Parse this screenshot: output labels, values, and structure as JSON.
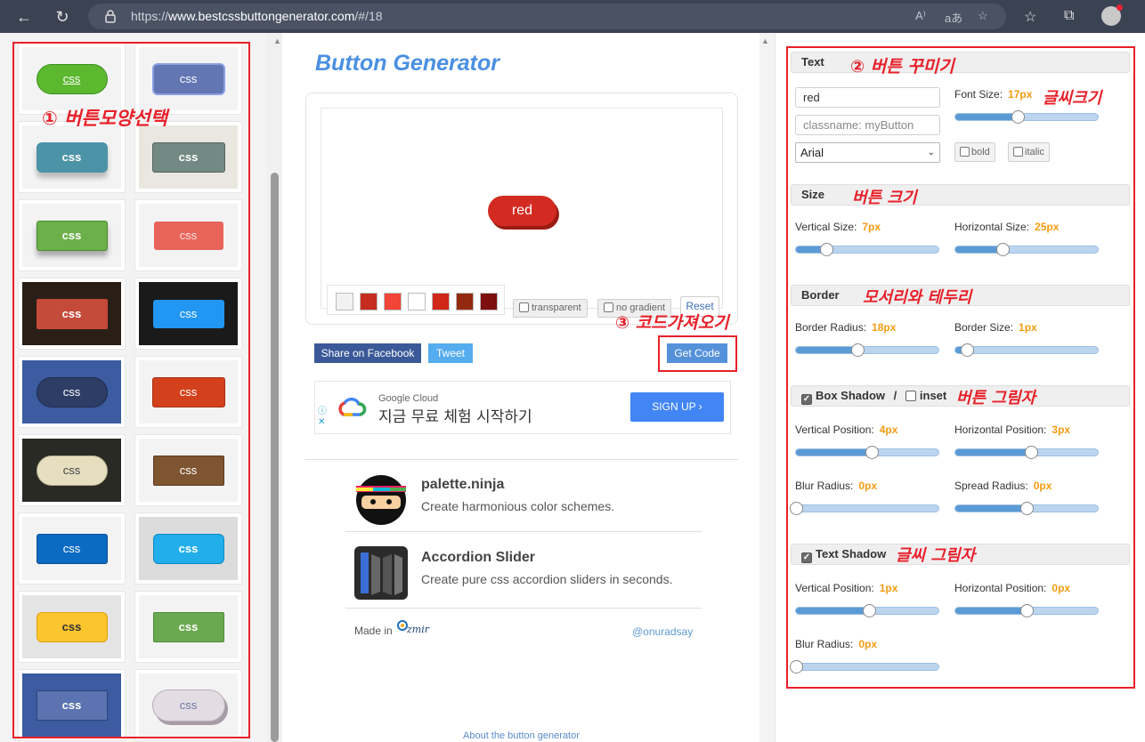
{
  "browser": {
    "url_prefix": "https://",
    "url_host": "www.bestcssbuttongenerator.com",
    "url_path": "/#/18"
  },
  "left": {
    "annotation": "① 버튼모양선택",
    "thumb_label": "css"
  },
  "center": {
    "title": "Button Generator",
    "preview_button_text": "red",
    "swatch_colors": [
      "#f2f2f2",
      "#c62d1f",
      "#f24437",
      "#ffffff",
      "#d02718",
      "#942911",
      "#7d0f0f"
    ],
    "transparent_label": "transparent",
    "no_gradient_label": "no gradient",
    "reset_label": "Reset",
    "facebook_label": "Share on Facebook",
    "tweet_label": "Tweet",
    "get_code_label": "Get Code",
    "code_annotation": "③ 코드가져오기",
    "ad": {
      "brand": "Google Cloud",
      "headline": "지금 무료 체험 시작하기",
      "cta": "SIGN UP"
    },
    "promos": [
      {
        "name": "palette.ninja",
        "desc": "Create harmonious color schemes."
      },
      {
        "name": "Accordion Slider",
        "desc": "Create pure css accordion sliders in seconds."
      }
    ],
    "made_in": "Made in",
    "twitter_handle": "@onuradsay",
    "about": "About the button generator"
  },
  "right": {
    "text_section": "Text",
    "text_annotation": "② 버튼 꾸미기",
    "text_value": "red",
    "classname_placeholder": "classname: myButton",
    "font_size_label": "Font Size:",
    "font_size_value": "17px",
    "font_size_annotation": "글씨크기",
    "font_select": "Arial",
    "bold_label": "bold",
    "italic_label": "italic",
    "size_section": "Size",
    "size_annotation": "버튼 크기",
    "vsize_label": "Vertical Size:",
    "vsize_value": "7px",
    "hsize_label": "Horizontal Size:",
    "hsize_value": "25px",
    "border_section": "Border",
    "border_annotation": "모서리와 테두리",
    "radius_label": "Border Radius:",
    "radius_value": "18px",
    "bsize_label": "Border Size:",
    "bsize_value": "1px",
    "boxshadow_section": "Box Shadow",
    "inset_label": "inset",
    "boxshadow_annotation": "버튼 그림자",
    "bs_vpos_label": "Vertical Position:",
    "bs_vpos_value": "4px",
    "bs_hpos_label": "Horizontal Position:",
    "bs_hpos_value": "3px",
    "bs_blur_label": "Blur Radius:",
    "bs_blur_value": "0px",
    "bs_spread_label": "Spread Radius:",
    "bs_spread_value": "0px",
    "textshadow_section": "Text Shadow",
    "textshadow_annotation": "글씨 그림자",
    "ts_vpos_label": "Vertical Position:",
    "ts_vpos_value": "1px",
    "ts_hpos_label": "Horizontal Position:",
    "ts_hpos_value": "0px",
    "ts_blur_label": "Blur Radius:",
    "ts_blur_value": "0px"
  },
  "slider_levels": {
    "font_size": 0.44,
    "vsize": 0.21,
    "hsize": 0.33,
    "radius": 0.43,
    "bsize": 0.08,
    "bs_vpos": 0.53,
    "bs_hpos": 0.53,
    "bs_blur": 0.0,
    "bs_spread": 0.5,
    "ts_vpos": 0.51,
    "ts_hpos": 0.5,
    "ts_blur": 0.0
  }
}
